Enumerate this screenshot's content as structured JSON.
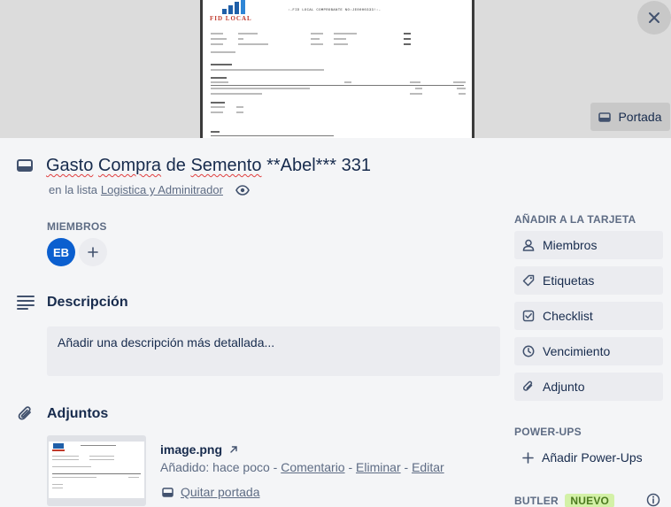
{
  "cover": {
    "document": {
      "logo_text": "FID LOCAL",
      "title_text": ":-FID LOCAL COMPROBANTE NO:JE0000333!:-"
    },
    "close_icon": "close-icon",
    "portada_button_label": "Portada"
  },
  "card": {
    "title_words": [
      "Gasto",
      "Compra",
      "de",
      "Semento",
      "**Abel***",
      "331"
    ],
    "list_prefix": "en la lista",
    "list_name": "Logistica y Adminitrador"
  },
  "members": {
    "label": "MIEMBROS",
    "avatars": [
      {
        "initials": "EB",
        "color": "#0b5fcf"
      }
    ]
  },
  "description": {
    "title": "Descripción",
    "placeholder": "Añadir una descripción más detallada..."
  },
  "attachments": {
    "title": "Adjuntos",
    "items": [
      {
        "name": "image.png",
        "added": "Añadido: hace poco",
        "separator": "-",
        "actions": [
          "Comentario",
          "Eliminar",
          "Editar"
        ],
        "remove_cover": "Quitar portada"
      }
    ]
  },
  "sidebar": {
    "add_to_card_label": "AÑADIR A LA TARJETA",
    "add_buttons": [
      {
        "label": "Miembros",
        "icon": "person-icon"
      },
      {
        "label": "Etiquetas",
        "icon": "tag-icon"
      },
      {
        "label": "Checklist",
        "icon": "checklist-icon"
      },
      {
        "label": "Vencimiento",
        "icon": "clock-icon"
      },
      {
        "label": "Adjunto",
        "icon": "paperclip-icon"
      }
    ],
    "powerups_label": "POWER-UPS",
    "add_powerups": "Añadir Power-Ups",
    "butler_label": "BUTLER",
    "butler_badge": "NUEVO"
  }
}
